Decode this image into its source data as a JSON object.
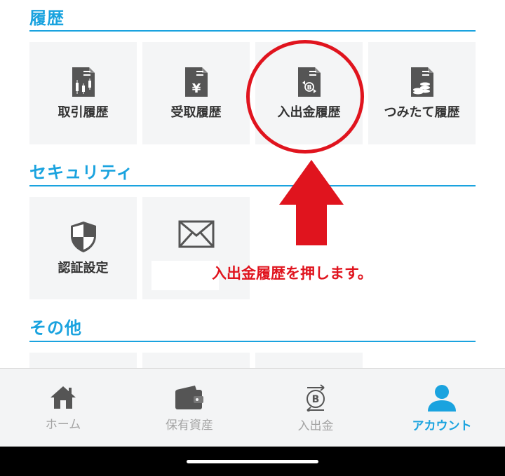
{
  "sections": {
    "history": {
      "title": "履歴",
      "tiles": [
        {
          "label": "取引履歴",
          "icon": "trade-history-icon"
        },
        {
          "label": "受取履歴",
          "icon": "receive-history-icon"
        },
        {
          "label": "入出金履歴",
          "icon": "deposit-withdraw-history-icon"
        },
        {
          "label": "つみたて履歴",
          "icon": "accumulation-history-icon"
        }
      ]
    },
    "security": {
      "title": "セキュリティ",
      "tiles": [
        {
          "label": "認証設定",
          "icon": "shield-icon"
        },
        {
          "label": "",
          "icon": "mail-icon"
        }
      ]
    },
    "other": {
      "title": "その他"
    }
  },
  "annotation": {
    "text": "入出金履歴を押します。",
    "color": "#e0141e"
  },
  "tabbar": {
    "tabs": [
      {
        "label": "ホーム",
        "icon": "home-icon",
        "active": false
      },
      {
        "label": "保有資産",
        "icon": "wallet-icon",
        "active": false
      },
      {
        "label": "入出金",
        "icon": "bitcoin-transfer-icon",
        "active": false
      },
      {
        "label": "アカウント",
        "icon": "person-icon",
        "active": true
      }
    ]
  },
  "colors": {
    "accent": "#1aa3df",
    "tile_bg": "#f4f5f6",
    "icon_dark": "#555555",
    "inactive_tab": "#a3a3a3"
  }
}
